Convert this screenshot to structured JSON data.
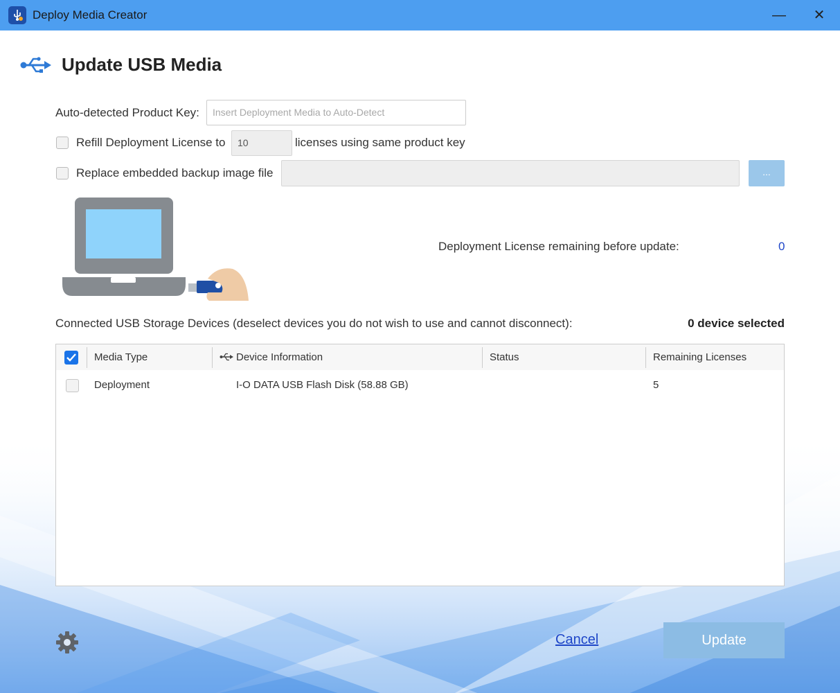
{
  "window": {
    "title": "Deploy Media Creator",
    "minimize_glyph": "—",
    "close_glyph": "✕"
  },
  "page": {
    "title": "Update USB Media"
  },
  "form": {
    "product_key_label": "Auto-detected Product Key:",
    "product_key_placeholder": "Insert Deployment Media to Auto-Detect",
    "refill_label": "Refill Deployment License to",
    "refill_value": "10",
    "refill_suffix": "licenses using same product key",
    "replace_label": "Replace embedded backup image file",
    "browse_label": "...",
    "refill_checked": false,
    "replace_checked": false
  },
  "license": {
    "remaining_label": "Deployment License remaining before update:",
    "remaining_value": "0"
  },
  "devices": {
    "label": "Connected USB Storage Devices (deselect devices you do not wish to use and cannot disconnect):",
    "selected_count": "0 device selected",
    "columns": [
      "Media Type",
      "Device Information",
      "Status",
      "Remaining Licenses"
    ],
    "rows": [
      {
        "media_type": "Deployment",
        "device_info": "I-O DATA USB Flash Disk (58.88 GB)",
        "status": "",
        "remaining": "5",
        "checked": false
      }
    ]
  },
  "footer": {
    "cancel_label": "Cancel",
    "update_label": "Update"
  },
  "colors": {
    "titlebar": "#4d9ef0",
    "accent": "#1a73e8",
    "link": "#1e46c8",
    "update_button": "#8cbce4"
  },
  "icons": [
    "usb-icon",
    "gear-icon",
    "checkmark-icon",
    "laptop-illustration"
  ]
}
